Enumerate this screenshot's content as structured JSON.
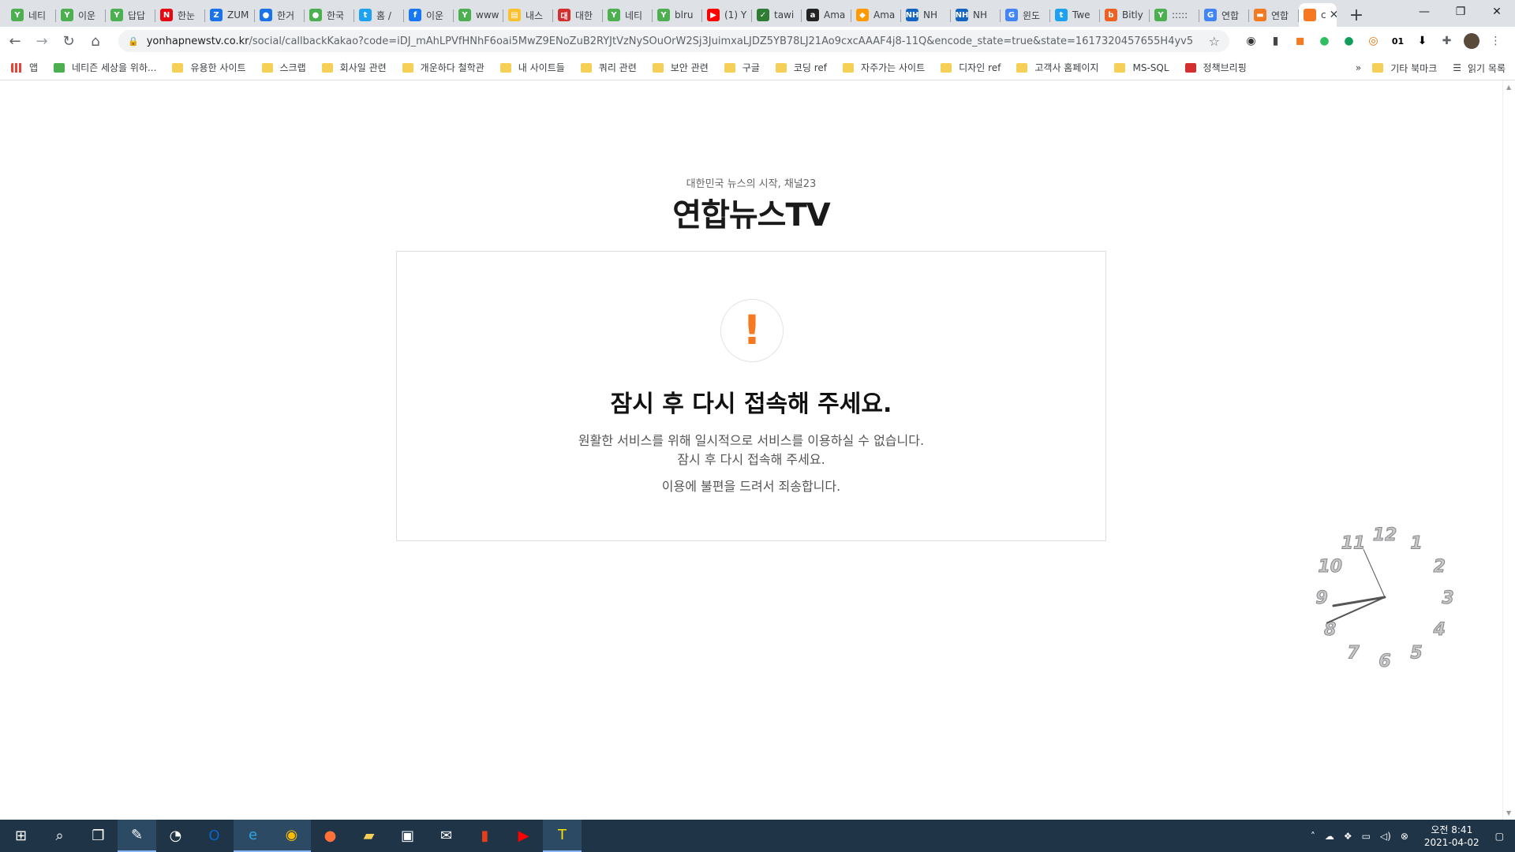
{
  "tabs": [
    {
      "label": "네티",
      "icon": "naver-leaf-icon",
      "color": "#4caf50"
    },
    {
      "label": "이운",
      "icon": "naver-leaf-icon",
      "color": "#4caf50"
    },
    {
      "label": "답답",
      "icon": "naver-leaf-icon",
      "color": "#4caf50"
    },
    {
      "label": "한눈",
      "icon": "netflix-icon",
      "color": "#e50914"
    },
    {
      "label": "ZUM",
      "icon": "zum-icon",
      "color": "#1a73e8"
    },
    {
      "label": "한거",
      "icon": "person-icon",
      "color": "#1a73e8"
    },
    {
      "label": "한국",
      "icon": "person-icon",
      "color": "#4caf50"
    },
    {
      "label": "홈 /",
      "icon": "twitter-icon",
      "color": "#1da1f2"
    },
    {
      "label": "이운",
      "icon": "facebook-icon",
      "color": "#1877f2"
    },
    {
      "label": "www",
      "icon": "naver-leaf-icon",
      "color": "#4caf50"
    },
    {
      "label": "내스",
      "icon": "note-icon",
      "color": "#fbc02d"
    },
    {
      "label": "대한",
      "icon": "korea-gov-icon",
      "color": "#d32f2f"
    },
    {
      "label": "네티",
      "icon": "naver-leaf-icon",
      "color": "#4caf50"
    },
    {
      "label": "blru",
      "icon": "naver-leaf-icon",
      "color": "#4caf50"
    },
    {
      "label": "(1) Y",
      "icon": "youtube-icon",
      "color": "#ff0000"
    },
    {
      "label": "tawi",
      "icon": "bird-icon",
      "color": "#2e7d32"
    },
    {
      "label": "Ama",
      "icon": "amazon-icon",
      "color": "#222222"
    },
    {
      "label": "Ama",
      "icon": "aws-icon",
      "color": "#ff9900"
    },
    {
      "label": "NH",
      "icon": "nh-icon",
      "color": "#1565c0"
    },
    {
      "label": "NH",
      "icon": "nh-icon",
      "color": "#1565c0"
    },
    {
      "label": "윈도",
      "icon": "google-icon",
      "color": "#4285f4"
    },
    {
      "label": "Twe",
      "icon": "twitter-icon",
      "color": "#1da1f2"
    },
    {
      "label": "Bitly",
      "icon": "bitly-icon",
      "color": "#ee6123"
    },
    {
      "label": ":::::",
      "icon": "naver-leaf-icon",
      "color": "#4caf50"
    },
    {
      "label": "연합",
      "icon": "google-icon",
      "color": "#4285f4"
    },
    {
      "label": "연합",
      "icon": "yonhap-icon",
      "color": "#f47920"
    }
  ],
  "active_tab": {
    "label": "c",
    "icon": "yonhap-icon",
    "color": "#f47920"
  },
  "window": {
    "minimize": "—",
    "restore": "❐",
    "close": "✕",
    "newtab": "+"
  },
  "address": {
    "host": "yonhapnewstv.co.kr",
    "path": "/social/callbackKakao?code=iDJ_mAhLPVfHNhF6oai5MwZ9ENoZuB2RYJtVzNySOuOrW2Sj3JuimxaLJDZ5YB78LJ21Ao9cxcAAAF4j8-11Q&encode_state=true&state=1617320457655H4yv5"
  },
  "bookmarks": [
    {
      "label": "앱",
      "icon": "apps-icon"
    },
    {
      "label": "네티즌 세상을 위하...",
      "icon": "naver-leaf-icon"
    },
    {
      "label": "유용한 사이트",
      "icon": "folder-icon"
    },
    {
      "label": "스크랩",
      "icon": "folder-icon"
    },
    {
      "label": "회사일 관련",
      "icon": "folder-icon"
    },
    {
      "label": "개운하다 철학관",
      "icon": "folder-icon"
    },
    {
      "label": "내 사이트들",
      "icon": "folder-icon"
    },
    {
      "label": "쿼리 관련",
      "icon": "folder-icon"
    },
    {
      "label": "보안 관련",
      "icon": "folder-icon"
    },
    {
      "label": "구글",
      "icon": "folder-icon"
    },
    {
      "label": "코딩 ref",
      "icon": "folder-icon"
    },
    {
      "label": "자주가는 사이트",
      "icon": "folder-icon"
    },
    {
      "label": "디자인 ref",
      "icon": "folder-icon"
    },
    {
      "label": "고객사 홈페이지",
      "icon": "folder-icon"
    },
    {
      "label": "MS-SQL",
      "icon": "folder-icon"
    },
    {
      "label": "정책브리핑",
      "icon": "korea-gov-icon"
    }
  ],
  "bookmarks_right": {
    "more": "»",
    "other": "기타 북마크",
    "reading": "읽기 목록"
  },
  "page": {
    "slogan": "대한민국 뉴스의 시작, 채널23",
    "logo": "연합뉴스TV",
    "exclamation": "!",
    "title": "잠시 후 다시 접속해 주세요.",
    "msg1": "원활한 서비스를 위해 일시적으로 서비스를 이용하실 수 없습니다.",
    "msg2": "잠시 후 다시 접속해 주세요.",
    "msg3": "이용에 불편을 드려서 죄송합니다.",
    "accent": "#f47920"
  },
  "desktop_clock": {
    "numerals": [
      "12",
      "1",
      "2",
      "3",
      "4",
      "5",
      "6",
      "7",
      "8",
      "9",
      "10",
      "11"
    ],
    "hour": 8,
    "minute": 41
  },
  "taskbar": {
    "icons": [
      "windows-start-icon",
      "search-icon",
      "task-view-icon",
      "stylus-icon",
      "clock-app-icon",
      "outlook-icon",
      "edge-icon",
      "chrome-icon",
      "firefox-icon",
      "file-explorer-icon",
      "store-icon",
      "mail-icon",
      "office-icon",
      "youtube-music-icon",
      "kakaotalk-icon"
    ],
    "time": "오전 8:41",
    "date": "2021-04-02"
  }
}
